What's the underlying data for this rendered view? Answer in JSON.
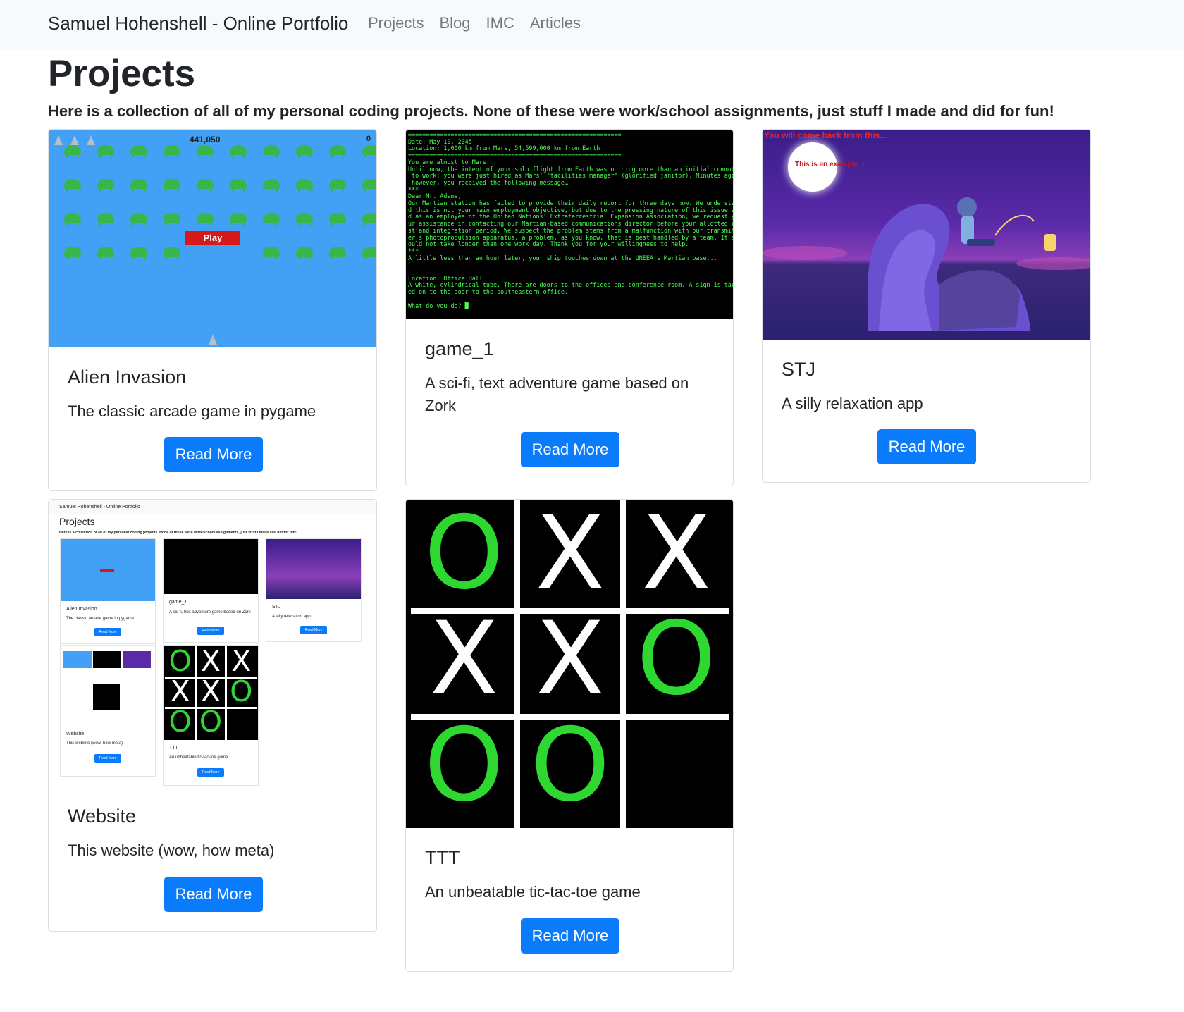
{
  "nav": {
    "brand": "Samuel Hohenshell - Online Portfolio",
    "links": [
      "Projects",
      "Blog",
      "IMC",
      "Articles"
    ]
  },
  "page": {
    "title": "Projects",
    "intro": "Here is a collection of all of my personal coding projects. None of these were work/school assignments, just stuff I made and did for fun!"
  },
  "cards": [
    {
      "title": "Alien Invasion",
      "text": "The classic arcade game in pygame",
      "button": "Read More"
    },
    {
      "title": "game_1",
      "text": "A sci-fi, text adventure game based on Zork",
      "button": "Read More"
    },
    {
      "title": "STJ",
      "text": "A silly relaxation app",
      "button": "Read More"
    },
    {
      "title": "Website",
      "text": "This website (wow, how meta)",
      "button": "Read More"
    },
    {
      "title": "TTT",
      "text": "An unbeatable tic-tac-toe game",
      "button": "Read More"
    }
  ],
  "alien_thumb": {
    "score": "441,050",
    "level": "0",
    "ships_left": "1",
    "play_label": "Play"
  },
  "game1_thumb": {
    "terminal": "============================================================\nDate: May 10, 2045\nLocation: 1,000 km from Mars, 54,599,000 km from Earth\n============================================================\nYou are almost to Mars.\nUntil now, the intent of your solo flight from Earth was nothing more than an initial commute\n to work; you were just hired as Mars' \"facilities manager\" (glorified janitor). Minutes ago,\n however, you received the following message…\n***\nDear Mr. Adams,\nOur Martian station has failed to provide their daily report for three days now. We understan\nd this is not your main employment objective, but due to the pressing nature of this issue an\nd as an employee of the United Nations' Extraterrestrial Expansion Association, we request yo\nur assistance in contacting our Martian-based communications director before your allotted re\nst and integration period. We suspect the problem stems from a malfunction with our transmitt\ner's photopropulsion apparatus, a problem, as you know, that is best handled by a team. It sh\nould not take longer than one work day. Thank you for your willingness to help.\n***\nA little less than an hour later, your ship touches down at the UNEEA's Martian base...\n\n\nLocation: Office Hall\nA white, cylindrical tube. There are doors to the offices and conference room. A sign is tack\ned on to the door to the southeastern office.\n\nWhat do you do? █"
  },
  "stj_thumb": {
    "top_text": "You will come back from this...",
    "bubble_text": "This is an example :)"
  },
  "ttt_board": [
    "O",
    "X",
    "X",
    "X",
    "X",
    "O",
    "O",
    "O",
    ""
  ],
  "colors": {
    "primary": "#0a7bfa",
    "nav_bg": "#f8f9fa",
    "alien_bg": "#42a1f4",
    "alien_green": "#39b54a",
    "play_red": "#d61a1a",
    "terminal_green": "#48ff52",
    "ttt_green": "#2fd831"
  },
  "icons": [
    "alien-icon",
    "ship-icon"
  ]
}
